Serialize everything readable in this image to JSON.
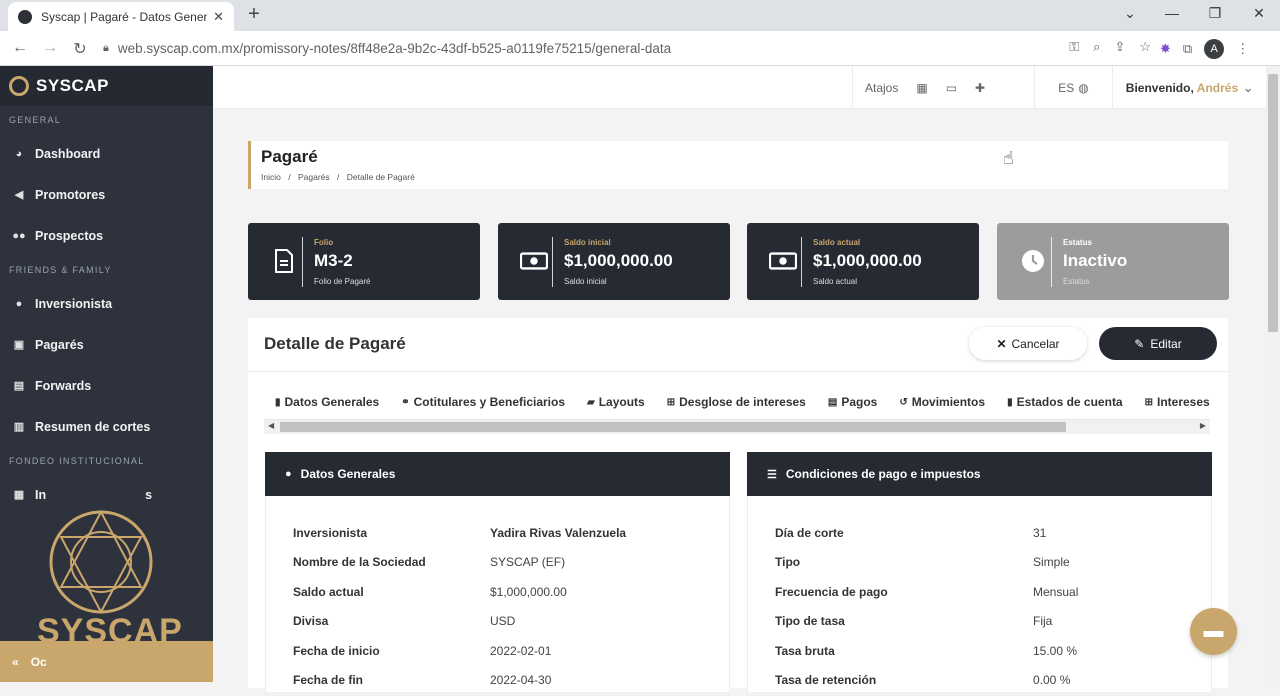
{
  "browser": {
    "tab_title": "Syscap | Pagaré - Datos Generales",
    "new_tab": "+",
    "url": "web.syscap.com.mx/promissory-notes/8ff48e2a-9b2c-43df-b525-a0119fe75215/general-data",
    "profile_initial": "A"
  },
  "sidebar": {
    "brand": "SYSCAP",
    "sections": [
      {
        "title": "GENERAL",
        "items": [
          {
            "label": "Dashboard",
            "icon": "gauge-icon"
          },
          {
            "label": "Promotores",
            "icon": "megaphone-icon"
          },
          {
            "label": "Prospectos",
            "icon": "users-icon"
          }
        ]
      },
      {
        "title": "FRIENDS & FAMILY",
        "items": [
          {
            "label": "Inversionista",
            "icon": "user-icon"
          },
          {
            "label": "Pagarés",
            "icon": "money-icon"
          },
          {
            "label": "Forwards",
            "icon": "ticket-icon"
          },
          {
            "label": "Resumen de cortes",
            "icon": "chart-icon"
          }
        ]
      },
      {
        "title": "FONDEO INSTITUCIONAL",
        "items": [
          {
            "label": "In",
            "icon": "bank-icon"
          }
        ]
      }
    ],
    "hidden_fragment": "s",
    "footer_label": "Oc",
    "watermark": "SYSCAP"
  },
  "topbar": {
    "shortcuts_label": "Atajos",
    "language": "ES",
    "welcome": "Bienvenido,",
    "user_name": "Andrés"
  },
  "page": {
    "title": "Pagaré",
    "breadcrumb": [
      "Inicio",
      "/",
      "Pagarés",
      "/",
      "Detalle de Pagaré"
    ]
  },
  "stats": [
    {
      "label": "Folio",
      "value": "M3-2",
      "sub": "Folio de Pagaré",
      "icon": "document-icon"
    },
    {
      "label": "Saldo inicial",
      "value": "$1,000,000.00",
      "sub": "Saldo inicial",
      "icon": "money-icon"
    },
    {
      "label": "Saldo actual",
      "value": "$1,000,000.00",
      "sub": "Saldo actual",
      "icon": "money-icon"
    },
    {
      "label": "Estatus",
      "value": "Inactivo",
      "sub": "Estatus",
      "icon": "clock-icon"
    }
  ],
  "detail": {
    "title": "Detalle de Pagaré",
    "cancel_label": "Cancelar",
    "edit_label": "Editar",
    "tabs": [
      {
        "label": "Datos Generales",
        "icon": "document-icon"
      },
      {
        "label": "Cotitulares y Beneficiarios",
        "icon": "handshake-icon"
      },
      {
        "label": "Layouts",
        "icon": "folder-icon"
      },
      {
        "label": "Desglose de intereses",
        "icon": "table-icon"
      },
      {
        "label": "Pagos",
        "icon": "money-icon"
      },
      {
        "label": "Movimientos",
        "icon": "history-icon"
      },
      {
        "label": "Estados de cuenta",
        "icon": "document-icon"
      },
      {
        "label": "Intereses",
        "icon": "table-icon"
      }
    ]
  },
  "general_panel": {
    "title": "Datos Generales",
    "rows": [
      {
        "k": "Inversionista",
        "v": "Yadira Rivas Valenzuela"
      },
      {
        "k": "Nombre de la Sociedad",
        "v": "SYSCAP (EF)"
      },
      {
        "k": "Saldo actual",
        "v": "$1,000,000.00"
      },
      {
        "k": "Divisa",
        "v": "USD"
      },
      {
        "k": "Fecha de inicio",
        "v": "2022-02-01"
      },
      {
        "k": "Fecha de fin",
        "v": "2022-04-30"
      }
    ]
  },
  "payment_panel": {
    "title": "Condiciones de pago e impuestos",
    "rows": [
      {
        "k": "Día de corte",
        "v": "31"
      },
      {
        "k": "Tipo",
        "v": "Simple"
      },
      {
        "k": "Frecuencia de pago",
        "v": "Mensual"
      },
      {
        "k": "Tipo de tasa",
        "v": "Fija"
      },
      {
        "k": "Tasa bruta",
        "v": "15.00 %"
      },
      {
        "k": "Tasa de retención",
        "v": "0.00 %"
      }
    ]
  },
  "colors": {
    "accent": "#c9a66b",
    "dark": "#252a33",
    "sidebar": "#2d323d",
    "inactive": "#9c9c9c"
  }
}
